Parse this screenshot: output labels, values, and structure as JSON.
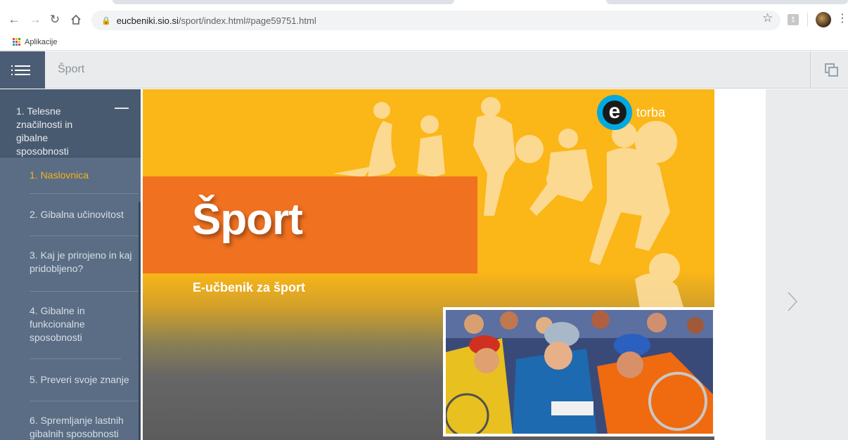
{
  "browser": {
    "url_host": "eucbeniki.sio.si",
    "url_path": "/sport/index.html#page59751.html",
    "bookmarks_label": "Aplikacije"
  },
  "app": {
    "title": "Šport"
  },
  "sidebar": {
    "chapter_label": "1. Telesne značilnosti in gibalne sposobnosti",
    "items": [
      {
        "label": "1. Naslovnica",
        "active": true
      },
      {
        "label": "2. Gibalna učinovitost",
        "active": false
      },
      {
        "label": "3. Kaj je prirojeno in kaj pridobljeno?",
        "active": false
      },
      {
        "label": "4. Gibalne in funkcionalne sposobnosti",
        "active": false
      },
      {
        "label": "5. Preveri svoje znanje",
        "active": false
      },
      {
        "label": "6. Spremljanje lastnih gibalnih sposobnosti",
        "active": false
      }
    ]
  },
  "cover": {
    "title": "Šport",
    "subtitle": "E-učbenik za šport",
    "logo_text": "torba"
  },
  "colors": {
    "sidebar": "#4b5d74",
    "active_item": "#f7b21b",
    "cover_yellow": "#fbb617",
    "cover_orange": "#f07120",
    "logo_blue": "#00a9e0"
  }
}
